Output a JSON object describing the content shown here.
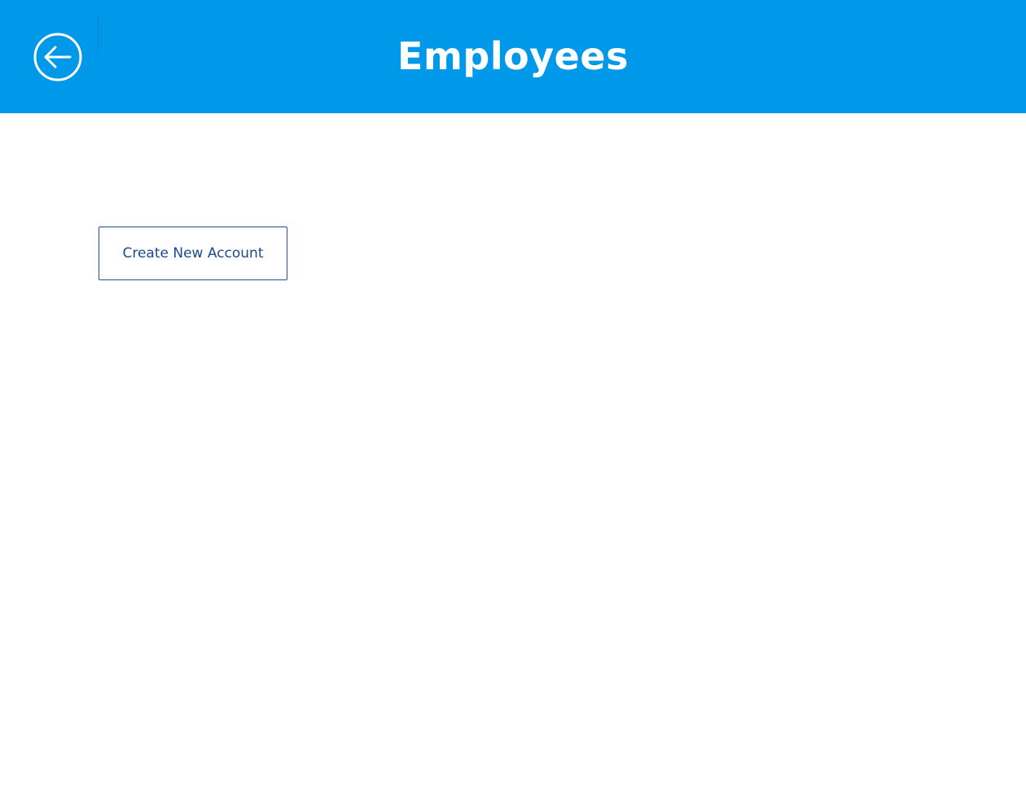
{
  "header": {
    "title": "Employees",
    "back_icon": "arrow-left-circle-icon",
    "background_color": "#0098e8"
  },
  "main": {
    "create_account_label": "Create New Account",
    "accent_color": "#1a4a8f"
  }
}
